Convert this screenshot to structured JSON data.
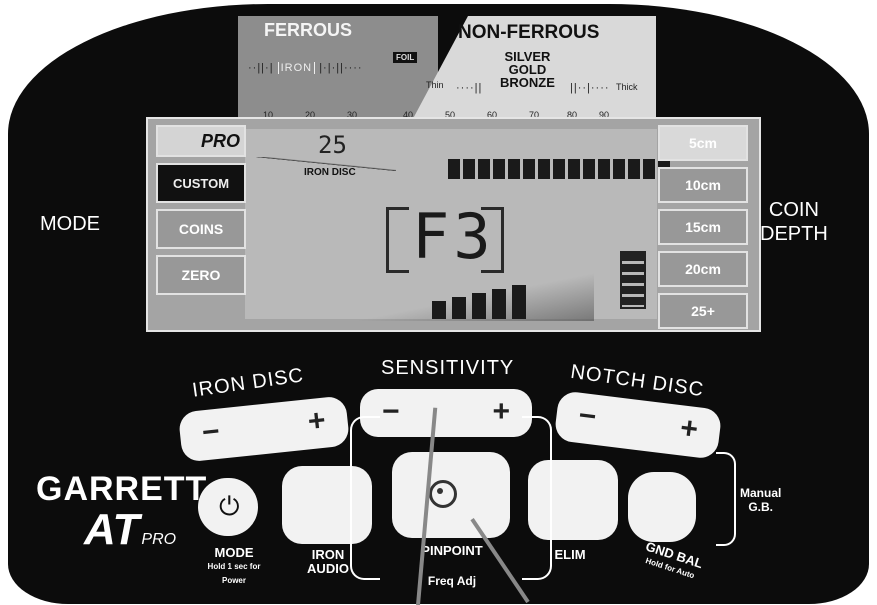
{
  "scale": {
    "ferrous_label": "FERROUS",
    "nonferrous_label": "NON-FERROUS",
    "foil": "FOIL",
    "iron": "IRON",
    "metals": [
      "SILVER",
      "GOLD",
      "BRONZE"
    ],
    "thin": "Thin",
    "thick": "Thick",
    "ticks": [
      "10",
      "20",
      "30",
      "40",
      "50",
      "60",
      "70",
      "80",
      "90"
    ]
  },
  "lcd": {
    "modes": [
      "PRO",
      "CUSTOM",
      "COINS",
      "ZERO"
    ],
    "selected_mode": "CUSTOM",
    "disc_value": "25",
    "iron_disc_label": "IRON DISC",
    "display_code": "F3",
    "depths": [
      "5cm",
      "10cm",
      "15cm",
      "20cm",
      "25+"
    ],
    "selected_depth": "5cm"
  },
  "side": {
    "mode": "MODE",
    "coin_depth": [
      "COIN",
      "DEPTH"
    ]
  },
  "controls": {
    "iron_disc": "IRON DISC",
    "sensitivity": "SENSITIVITY",
    "notch_disc": "NOTCH DISC",
    "minus": "−",
    "plus": "+",
    "mode_btn": "MODE",
    "mode_hint": "Hold 1 sec for Power",
    "iron_audio": [
      "IRON",
      "AUDIO"
    ],
    "pinpoint": "PINPOINT",
    "freq_adj": "Freq Adj",
    "elim": "ELIM",
    "gnd_bal": "GND BAL",
    "gnd_hint": "Hold for Auto",
    "manual_gb": [
      "Manual",
      "G.B."
    ]
  },
  "brand": {
    "maker": "GARRETT",
    "model": "AT",
    "model_suffix": "PRO"
  }
}
